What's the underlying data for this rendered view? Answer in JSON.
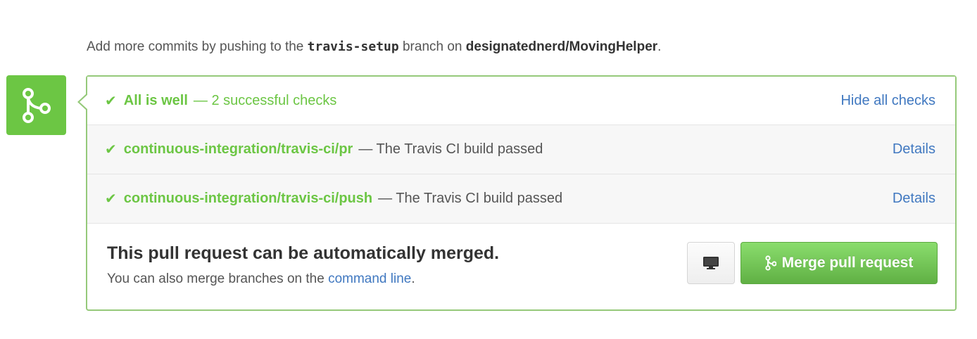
{
  "hint": {
    "prefix": "Add more commits by pushing to the",
    "branch": "travis-setup",
    "middle": "branch on",
    "repo": "designatednerd/MovingHelper",
    "suffix": "."
  },
  "status": {
    "summary_check": "✔",
    "summary_label": "All is well",
    "summary_detail": "— 2 successful checks",
    "toggle_label": "Hide all checks"
  },
  "checks": [
    {
      "mark": "✔",
      "context": "continuous-integration/travis-ci/pr",
      "description": "— The Travis CI build passed",
      "details_label": "Details"
    },
    {
      "mark": "✔",
      "context": "continuous-integration/travis-ci/push",
      "description": "— The Travis CI build passed",
      "details_label": "Details"
    }
  ],
  "merge": {
    "title": "This pull request can be automatically merged.",
    "sub_prefix": "You can also merge branches on the",
    "sub_link": "command line",
    "sub_suffix": ".",
    "button_label": "Merge pull request",
    "cli_button_icon": "monitor-icon",
    "merge_icon": "git-merge-icon"
  },
  "colors": {
    "success": "#6cc644",
    "link": "#4078c0",
    "border": "#95c97a"
  }
}
